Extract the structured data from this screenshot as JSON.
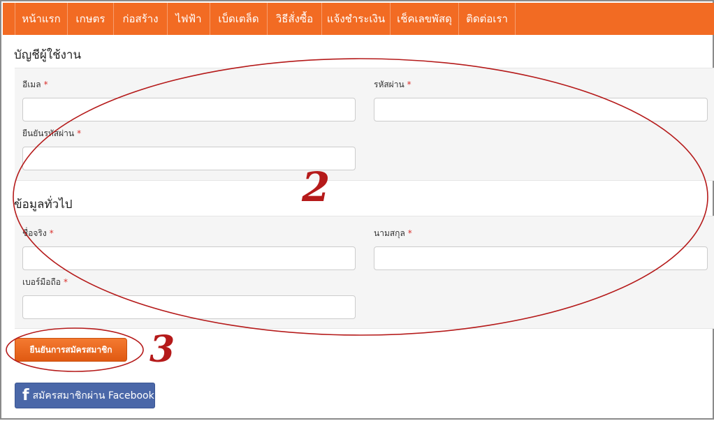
{
  "nav": {
    "items": [
      {
        "label": "หน้าแรก"
      },
      {
        "label": "เกษตร"
      },
      {
        "label": "ก่อสร้าง"
      },
      {
        "label": "ไฟฟ้า"
      },
      {
        "label": "เบ็ดเตล็ด"
      },
      {
        "label": "วิธีสั่งซื้อ"
      },
      {
        "label": "แจ้งชำระเงิน"
      },
      {
        "label": "เช็คเลขพัสดุ"
      },
      {
        "label": "ติดต่อเรา"
      }
    ]
  },
  "account": {
    "title": "บัญชีผู้ใช้งาน",
    "email": {
      "label": "อีเมล",
      "value": ""
    },
    "password": {
      "label": "รหัสผ่าน",
      "value": ""
    },
    "confirm_password": {
      "label": "ยืนยันรหัสผ่าน",
      "value": ""
    }
  },
  "general": {
    "title": "ข้อมูลทั่วไป",
    "first_name": {
      "label": "ชื่อจริง",
      "value": ""
    },
    "last_name": {
      "label": "นามสกุล",
      "value": ""
    },
    "mobile": {
      "label": "เบอร์มือถือ",
      "value": ""
    }
  },
  "required_mark": "*",
  "submit_label": "ยืนยันการสมัครสมาชิก",
  "facebook": {
    "icon": "facebook-icon",
    "label": "สมัครสมาชิกผ่าน Facebook"
  },
  "annotations": {
    "marker_2": "2",
    "marker_3": "3",
    "color": "#b51a1a"
  },
  "colors": {
    "nav": "#f26b23",
    "button": "#e86a22",
    "facebook": "#4a67a8",
    "panel": "#f5f5f5"
  }
}
